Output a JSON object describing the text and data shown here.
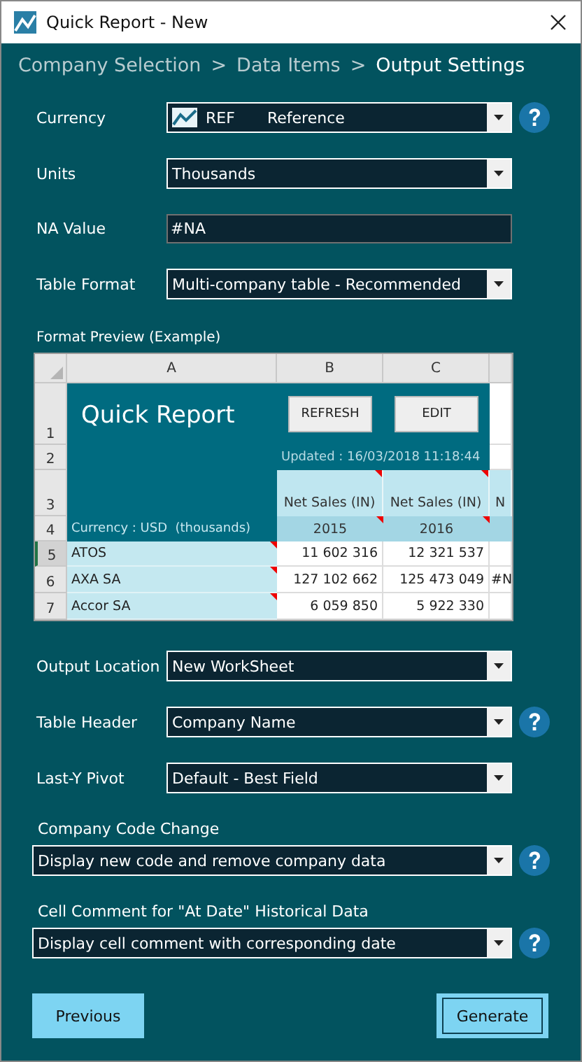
{
  "window": {
    "title": "Quick Report - New"
  },
  "breadcrumb": {
    "steps": [
      {
        "label": "Company Selection",
        "selected": false
      },
      {
        "label": "Data Items",
        "selected": false
      },
      {
        "label": "Output Settings",
        "selected": true
      }
    ],
    "separators": [
      ">",
      ">"
    ]
  },
  "settings": [
    {
      "kind": "select",
      "label": "Currency",
      "code": "REF",
      "value": "Reference",
      "help": true
    },
    {
      "kind": "select",
      "label": "Units",
      "value": "Thousands",
      "help": false
    },
    {
      "kind": "text",
      "label": "NA Value",
      "value": "#NA",
      "help": false
    },
    {
      "kind": "select",
      "label": "Table Format",
      "value": "Multi-company table - Recommended",
      "help": false
    }
  ],
  "preview": {
    "label": "Format Preview (Example)",
    "sheet": {
      "columns": [
        "A",
        "B",
        "C"
      ],
      "rows": [
        {
          "label": "1",
          "selected": false
        },
        {
          "label": "2",
          "selected": false
        },
        {
          "label": "3",
          "selected": false
        },
        {
          "label": "4",
          "selected": false
        },
        {
          "label": "5",
          "selected": true
        },
        {
          "label": "6",
          "selected": false
        },
        {
          "label": "7",
          "selected": false
        }
      ],
      "title": "Quick Report",
      "buttons": [
        "REFRESH",
        "EDIT"
      ],
      "updated": "Updated : 16/03/2018 11:18:44",
      "headers": [
        {
          "text": "Net Sales (IN)",
          "comment": true
        },
        {
          "text": "Net Sales (IN)",
          "comment": true
        },
        {
          "text": "N",
          "comment": false
        }
      ],
      "periods": [
        {
          "text": "2015",
          "comment": true
        },
        {
          "text": "2016",
          "comment": true
        }
      ],
      "currency_note": "Currency : USD  (thousands)",
      "companies": [
        {
          "name": "ATOS",
          "comment": true,
          "values": [
            "11 602 316",
            "12 321 537"
          ]
        },
        {
          "name": "AXA SA",
          "comment": true,
          "values": [
            "127 102 662",
            "125 473 049",
            "#N"
          ]
        },
        {
          "name": "Accor SA",
          "comment": true,
          "values": [
            "6 059 850",
            "5 922 330"
          ]
        }
      ]
    }
  },
  "output": [
    {
      "kind": "select",
      "label": "Output Location",
      "value": "New WorkSheet",
      "help": false
    },
    {
      "kind": "select",
      "label": "Table Header",
      "value": "Company Name",
      "help": true
    },
    {
      "kind": "select",
      "label": "Last-Y Pivot",
      "value": "Default - Best Field",
      "help": false
    }
  ],
  "options": [
    {
      "kind": "select",
      "label": "Company Code Change",
      "value": "Display new code and remove company data",
      "help": true
    },
    {
      "kind": "select",
      "label": "Cell Comment for \"At Date\" Historical Data",
      "value": "Display cell comment with corresponding date",
      "help": true
    }
  ],
  "buttons": [
    {
      "label": "Previous",
      "default": false
    },
    {
      "label": "Generate",
      "default": true
    }
  ]
}
